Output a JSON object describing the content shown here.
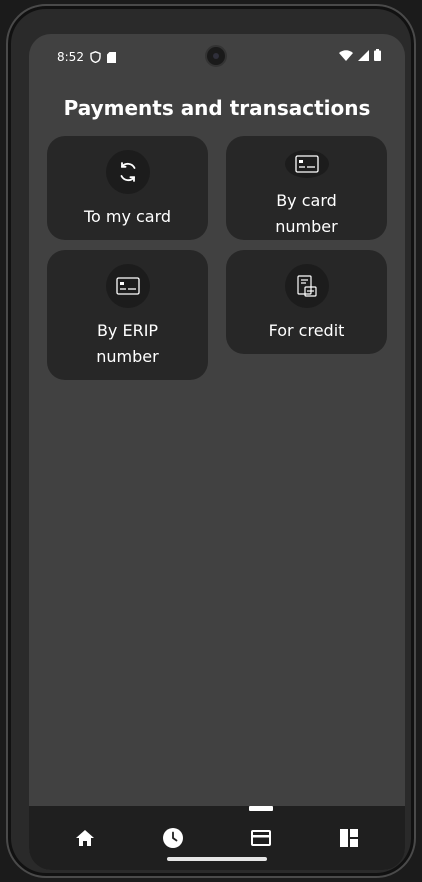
{
  "status_bar": {
    "time": "8:52"
  },
  "page": {
    "title": "Payments and transactions"
  },
  "tiles": [
    {
      "label": "To my card",
      "icon": "refresh-icon"
    },
    {
      "label": "By card number",
      "icon": "card-icon"
    },
    {
      "label": "By ERIP number",
      "icon": "card-icon"
    },
    {
      "label": "For credit",
      "icon": "bill-icon"
    }
  ],
  "bottom_nav": [
    {
      "icon": "home-icon"
    },
    {
      "icon": "clock-icon"
    },
    {
      "icon": "card-icon",
      "active": true
    },
    {
      "icon": "dashboard-icon"
    }
  ],
  "colors": {
    "background": "#414141",
    "tile": "#272727",
    "nav": "#1f1f1f",
    "text": "#ffffff"
  }
}
